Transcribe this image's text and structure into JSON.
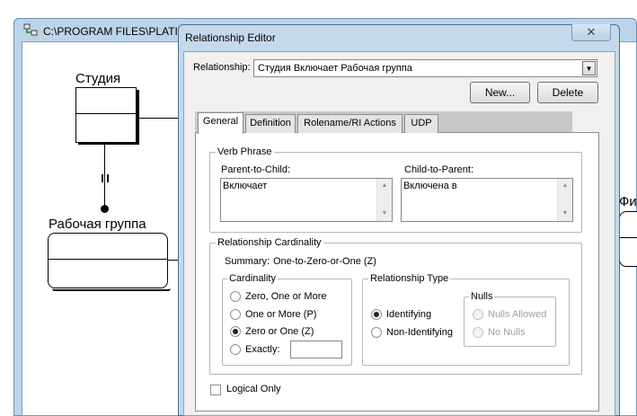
{
  "background_window": {
    "title": "C:\\PROGRAM FILES\\PLATIN",
    "entities": [
      {
        "name": "Студия"
      },
      {
        "name": "Рабочая группа"
      },
      {
        "name": "Фи"
      }
    ]
  },
  "dialog": {
    "title": "Relationship Editor",
    "close_glyph": "✕",
    "relationship_label": "Relationship:",
    "relationship_value": "Студия Включает Рабочая группа",
    "new_button": "New...",
    "delete_button": "Delete",
    "tabs": [
      {
        "label": "General",
        "active": true
      },
      {
        "label": "Definition",
        "active": false
      },
      {
        "label": "Rolename/RI Actions",
        "active": false
      },
      {
        "label": "UDP",
        "active": false
      }
    ],
    "verb_phrase": {
      "group_label": "Verb Phrase",
      "parent_to_child_label": "Parent-to-Child:",
      "parent_to_child_value": "Включает",
      "child_to_parent_label": "Child-to-Parent:",
      "child_to_parent_value": "Включена в"
    },
    "cardinality_group": {
      "group_label": "Relationship Cardinality",
      "summary_label": "Summary:",
      "summary_value": "One-to-Zero-or-One (Z)",
      "cardinality": {
        "group_label": "Cardinality",
        "options": [
          {
            "label": "Zero, One or More",
            "selected": false
          },
          {
            "label": "One or More (P)",
            "selected": false
          },
          {
            "label": "Zero or One (Z)",
            "selected": true
          },
          {
            "label": "Exactly:",
            "selected": false
          }
        ],
        "exactly_value": ""
      },
      "relationship_type": {
        "group_label": "Relationship Type",
        "options": [
          {
            "label": "Identifying",
            "selected": true
          },
          {
            "label": "Non-Identifying",
            "selected": false
          }
        ],
        "nulls": {
          "group_label": "Nulls",
          "options": [
            {
              "label": "Nulls Allowed",
              "enabled": false
            },
            {
              "label": "No Nulls",
              "enabled": false
            }
          ]
        }
      }
    },
    "logical_only_label": "Logical Only",
    "logical_only_checked": false
  }
}
